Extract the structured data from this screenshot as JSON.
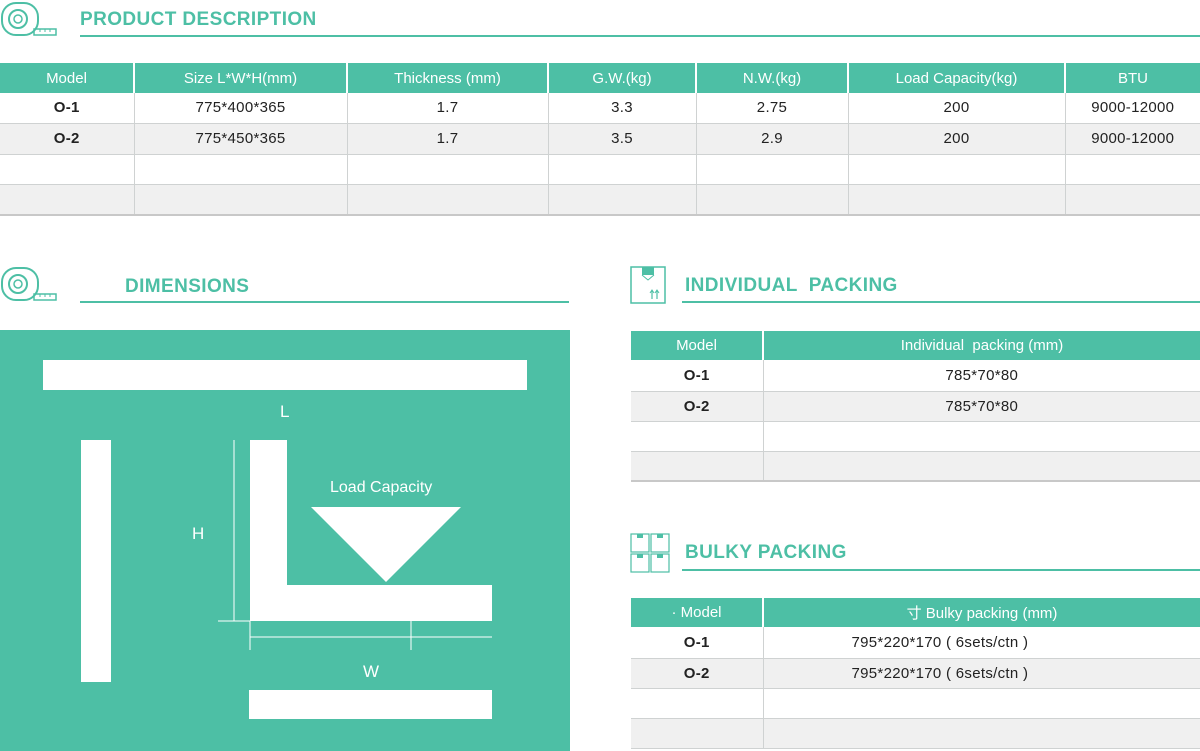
{
  "product": {
    "title": "PRODUCT DESCRIPTION",
    "headers": [
      "Model",
      "Size L*W*H(mm)",
      "Thickness (mm)",
      "G.W.(kg)",
      "N.W.(kg)",
      "Load Capacity(kg)",
      "BTU"
    ],
    "rows": [
      [
        "O-1",
        "775*400*365",
        "1.7",
        "3.3",
        "2.75",
        "200",
        "9000-12000"
      ],
      [
        "O-2",
        "775*450*365",
        "1.7",
        "3.5",
        "2.9",
        "200",
        "9000-12000"
      ],
      [
        "",
        "",
        "",
        "",
        "",
        "",
        ""
      ],
      [
        "",
        "",
        "",
        "",
        "",
        "",
        ""
      ]
    ]
  },
  "dimensions": {
    "title": "DIMENSIONS",
    "label_l": "L",
    "label_h": "H",
    "label_w": "W",
    "label_load": "Load Capacity"
  },
  "individual": {
    "title": "INDIVIDUAL  PACKING",
    "headers": [
      "Model",
      "Individual  packing (mm)"
    ],
    "rows": [
      [
        "O-1",
        "785*70*80"
      ],
      [
        "O-2",
        "785*70*80"
      ],
      [
        "",
        ""
      ],
      [
        "",
        ""
      ]
    ]
  },
  "bulky": {
    "title": "BULKY PACKING",
    "headers": [
      "· Model",
      "寸 Bulky packing (mm)"
    ],
    "rows": [
      [
        "O-1",
        "795*220*170 ( 6sets/ctn )"
      ],
      [
        "O-2",
        "795*220*170 ( 6sets/ctn )"
      ],
      [
        "",
        ""
      ],
      [
        "",
        ""
      ]
    ]
  },
  "colors": {
    "accent": "#4dbfa5",
    "row_alt": "#f0f0f0"
  },
  "icons": [
    "tape-measure-icon",
    "carton-box-icon",
    "carton-stack-icon"
  ]
}
